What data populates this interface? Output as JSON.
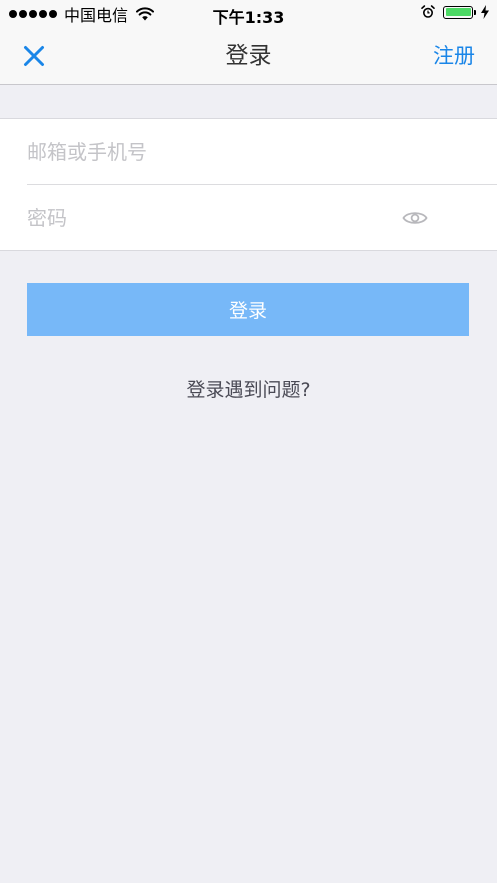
{
  "status_bar": {
    "carrier": "中国电信",
    "time": "下午1:33",
    "battery_level": 1.0,
    "battery_color": "#4cd964"
  },
  "nav": {
    "close_icon": "close-icon",
    "title": "登录",
    "register_label": "注册"
  },
  "form": {
    "account_placeholder": "邮箱或手机号",
    "account_value": "",
    "password_placeholder": "密码",
    "password_value": "",
    "password_toggle_icon": "eye-icon"
  },
  "login_button": {
    "label": "登录"
  },
  "trouble_link": {
    "label": "登录遇到问题?"
  },
  "colors": {
    "accent": "#1a86e8",
    "button_bg": "#77b8f8",
    "page_bg": "#efeff4"
  }
}
